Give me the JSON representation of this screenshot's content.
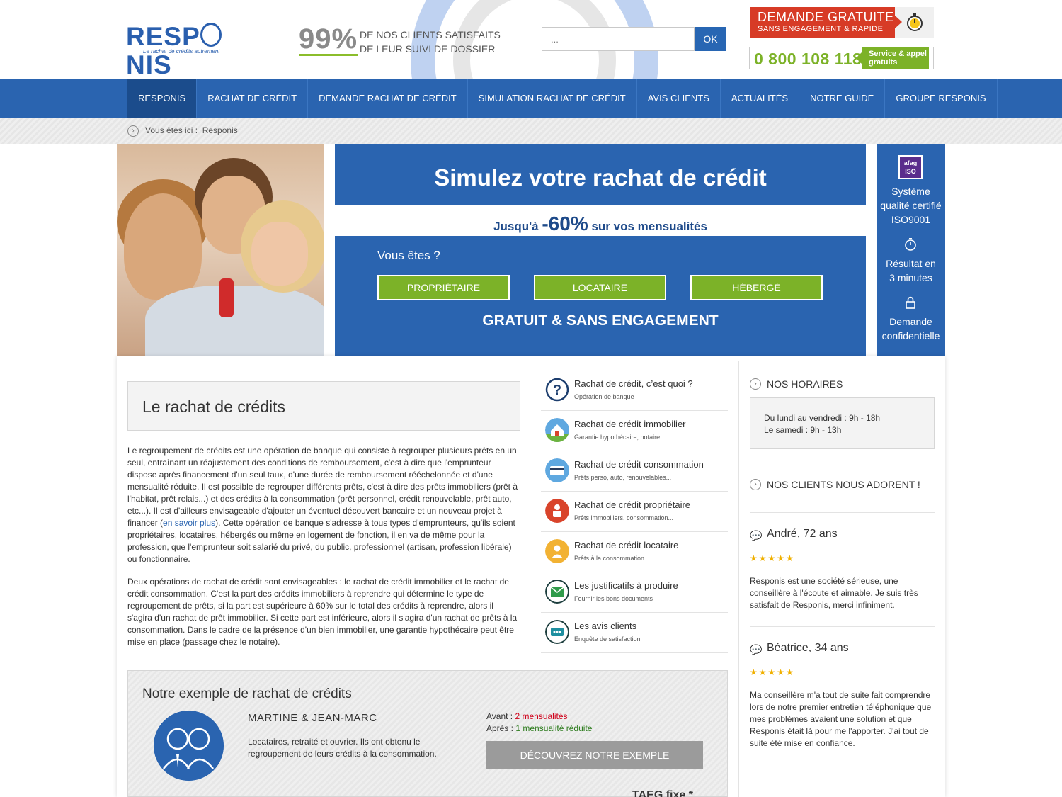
{
  "header": {
    "logo": {
      "word_left": "RESP",
      "word_right": "NIS",
      "tagline": "Le rachat de crédits    autrement"
    },
    "stat": {
      "value": "99%",
      "line1": "DE NOS CLIENTS SATISFAITS",
      "line2": "DE LEUR SUIVI DE DOSSIER"
    },
    "search": {
      "placeholder": "...",
      "button": "OK"
    },
    "cta": {
      "title": "DEMANDE GRATUITE",
      "subtitle": "SANS ENGAGEMENT & RAPIDE",
      "icon": "stopwatch-icon"
    },
    "phone": {
      "number": "0 800 108 118",
      "badge_line1": "Service & appel",
      "badge_line2": "gratuits"
    },
    "colors": {
      "brand_blue": "#2a64b0",
      "green": "#7cb228",
      "red": "#d73b26"
    }
  },
  "nav": {
    "items": [
      "RESPONIS",
      "RACHAT DE CRÉDIT",
      "DEMANDE RACHAT DE CRÉDIT",
      "SIMULATION RACHAT DE CRÉDIT",
      "AVIS CLIENTS",
      "ACTUALITÉS",
      "NOTRE GUIDE",
      "GROUPE RESPONIS"
    ],
    "active_index": 0
  },
  "breadcrumb": {
    "label": "Vous êtes ici :",
    "current": "Responis"
  },
  "simulator": {
    "title": "Simulez votre rachat de crédit",
    "promo_prefix": "Jusqu'à",
    "promo_value": "-60%",
    "promo_suffix": "sur vos mensualités",
    "question": "Vous êtes ?",
    "options": [
      "PROPRIÉTAIRE",
      "LOCATAIRE",
      "HÉBERGÉ"
    ],
    "footer": "GRATUIT & SANS ENGAGEMENT"
  },
  "quality": {
    "badge": "afag ISO 9001",
    "items": [
      {
        "icon": "certificate-icon",
        "text_lines": [
          "Système",
          "qualité certifié",
          "ISO9001"
        ]
      },
      {
        "icon": "stopwatch-icon",
        "text_lines": [
          "Résultat en",
          "3 minutes"
        ]
      },
      {
        "icon": "lock-icon",
        "text_lines": [
          "Demande",
          "confidentielle"
        ]
      }
    ]
  },
  "main": {
    "heading": "Le rachat de crédits",
    "paragraph1_a": "Le regroupement de crédits est une opération de banque qui consiste à regrouper plusieurs prêts en un seul, entraînant un réajustement des conditions de remboursement, c'est à dire que l'emprunteur dispose après financement d'un seul taux, d'une durée de remboursement rééchelonnée et d'une mensualité réduite. Il est possible de regrouper différents prêts, c'est à dire des prêts immobiliers (prêt à l'habitat, prêt relais...) et des crédits à la consommation (prêt personnel, crédit renouvelable, prêt auto, etc...). Il est d'ailleurs envisageable d'ajouter un éventuel découvert bancaire et un nouveau projet à financer (",
    "paragraph1_link": "en savoir plus",
    "paragraph1_b": "). Cette opération de banque s'adresse à tous types d'emprunteurs, qu'ils soient propriétaires, locataires, hébergés ou même en logement de fonction, il en va de même pour la profession, que l'emprunteur soit salarié du privé, du public, professionnel (artisan, profession libérale) ou fonctionnaire.",
    "paragraph2": "Deux opérations de rachat de crédit sont envisageables : le rachat de crédit immobilier et le rachat de crédit consommation. C'est la part des crédits immobiliers à reprendre qui détermine le type de regroupement de prêts, si la part est supérieure à 60% sur le total des crédits à reprendre, alors il s'agira d'un rachat de prêt immobilier. Si cette part est inférieure, alors il s'agira d'un rachat de prêts à la consommation. Dans le cadre de la présence d'un bien immobilier, une garantie hypothécaire peut être mise en place (passage chez le notaire)."
  },
  "links": [
    {
      "title": "Rachat de crédit, c’est quoi ?",
      "sub": "Opération de banque",
      "icon": "question-icon",
      "color": "#ffffff"
    },
    {
      "title": "Rachat de crédit immobilier",
      "sub": "Garantie hypothécaire, notaire...",
      "icon": "house-icon",
      "color": "#5fa8e0"
    },
    {
      "title": "Rachat de crédit consommation",
      "sub": "Prêts perso, auto, renouvelables...",
      "icon": "card-icon",
      "color": "#5fa8e0"
    },
    {
      "title": "Rachat de crédit propriétaire",
      "sub": "Prêts immobiliers, consommation...",
      "icon": "owner-icon",
      "color": "#d9442b"
    },
    {
      "title": "Rachat de crédit locataire",
      "sub": "Prêts à la consommation..",
      "icon": "tenant-icon",
      "color": "#f2b233"
    },
    {
      "title": "Les justificatifs à produire",
      "sub": "Fournir les bons documents",
      "icon": "envelope-icon",
      "color": "#2f9b4a"
    },
    {
      "title": "Les avis clients",
      "sub": "Enquête de satisfaction",
      "icon": "chat-icon",
      "color": "#1e8fa0"
    }
  ],
  "sidebar": {
    "hours_title": "NOS HORAIRES",
    "hours": [
      "Du lundi au vendredi : 9h - 18h",
      "Le samedi : 9h - 13h"
    ],
    "reviews_title": "NOS CLIENTS NOUS ADORENT !",
    "reviews": [
      {
        "name": "André, 72 ans",
        "stars": "★★★★★",
        "rating": 5,
        "text": "Responis est une société sérieuse, une conseillère à l'écoute et aimable. Je suis très satisfait de Responis, merci infiniment."
      },
      {
        "name": "Béatrice, 34 ans",
        "stars": "★★★★★",
        "rating": 5,
        "text": "Ma conseillère m'a tout de suite fait comprendre lors de notre premier entretien téléphonique que mes problèmes avaient une solution et que Responis était là pour me l'apporter. J'ai tout de suite été mise en confiance."
      }
    ]
  },
  "example": {
    "title": "Notre exemple de rachat de crédits",
    "name": "MARTINE & JEAN-MARC",
    "description": "Locataires, retraité et ouvrier. Ils ont obtenu le regroupement de leurs crédits à la consommation.",
    "before_label": "Avant :",
    "before_value": "2 mensualités",
    "after_label": "Après :",
    "after_value": "1 mensualité réduite",
    "button": "DÉCOUVREZ NOTRE EXEMPLE",
    "taeg": "TAEG fixe *"
  }
}
